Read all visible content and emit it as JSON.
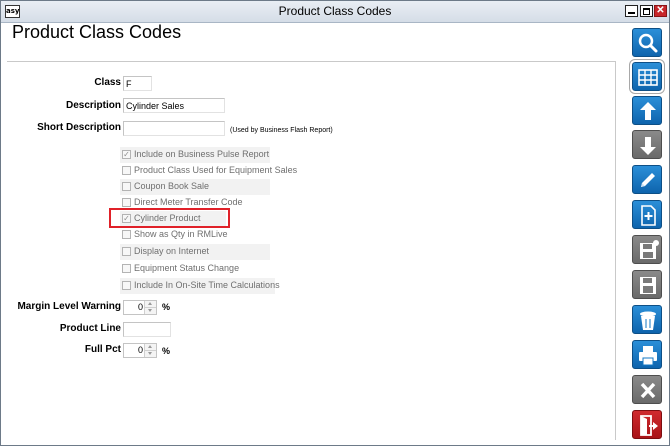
{
  "window": {
    "title": "Product Class Codes",
    "app_icon_text": "asy",
    "close_glyph": "✕"
  },
  "page": {
    "heading": "Product Class Codes"
  },
  "form": {
    "class": {
      "label": "Class",
      "value": "F"
    },
    "description": {
      "label": "Description",
      "value": "Cylinder Sales"
    },
    "short_description": {
      "label": "Short Description",
      "value": "",
      "note": "(Used by Business Flash Report)"
    },
    "checkboxes": [
      {
        "label": "Include on Business Pulse Report",
        "checked": true
      },
      {
        "label": "Product Class Used for Equipment Sales",
        "checked": false
      },
      {
        "label": "Coupon Book Sale",
        "checked": false
      },
      {
        "label": "Direct Meter Transfer Code",
        "checked": false
      },
      {
        "label": "Cylinder Product",
        "checked": true
      },
      {
        "label": "Show as Qty in RMLive",
        "checked": false
      },
      {
        "label": "Display on Internet",
        "checked": false
      },
      {
        "label": "Equipment Status Change",
        "checked": false
      },
      {
        "label": "Include In On-Site Time Calculations",
        "checked": false
      }
    ],
    "margin_level_warning": {
      "label": "Margin Level Warning",
      "value": "0",
      "unit": "%"
    },
    "product_line": {
      "label": "Product Line",
      "value": ""
    },
    "full_pct": {
      "label": "Full Pct",
      "value": "0",
      "unit": "%"
    }
  },
  "toolbar": [
    {
      "name": "search-icon",
      "style": "blue"
    },
    {
      "name": "grid-icon",
      "style": "blue",
      "selected": true
    },
    {
      "name": "arrow-up-icon",
      "style": "blue"
    },
    {
      "name": "arrow-down-icon",
      "style": "gray"
    },
    {
      "name": "edit-pencil-icon",
      "style": "blue"
    },
    {
      "name": "new-document-icon",
      "style": "blue"
    },
    {
      "name": "save-new-icon",
      "style": "gray"
    },
    {
      "name": "save-icon",
      "style": "gray"
    },
    {
      "name": "delete-trash-icon",
      "style": "blue"
    },
    {
      "name": "print-icon",
      "style": "blue"
    },
    {
      "name": "cancel-x-icon",
      "style": "gray"
    },
    {
      "name": "exit-door-icon",
      "style": "red"
    }
  ],
  "colors": {
    "accent_blue": "#1478c4",
    "highlight_red": "#e02129",
    "disabled_text": "#6f6f6f"
  }
}
